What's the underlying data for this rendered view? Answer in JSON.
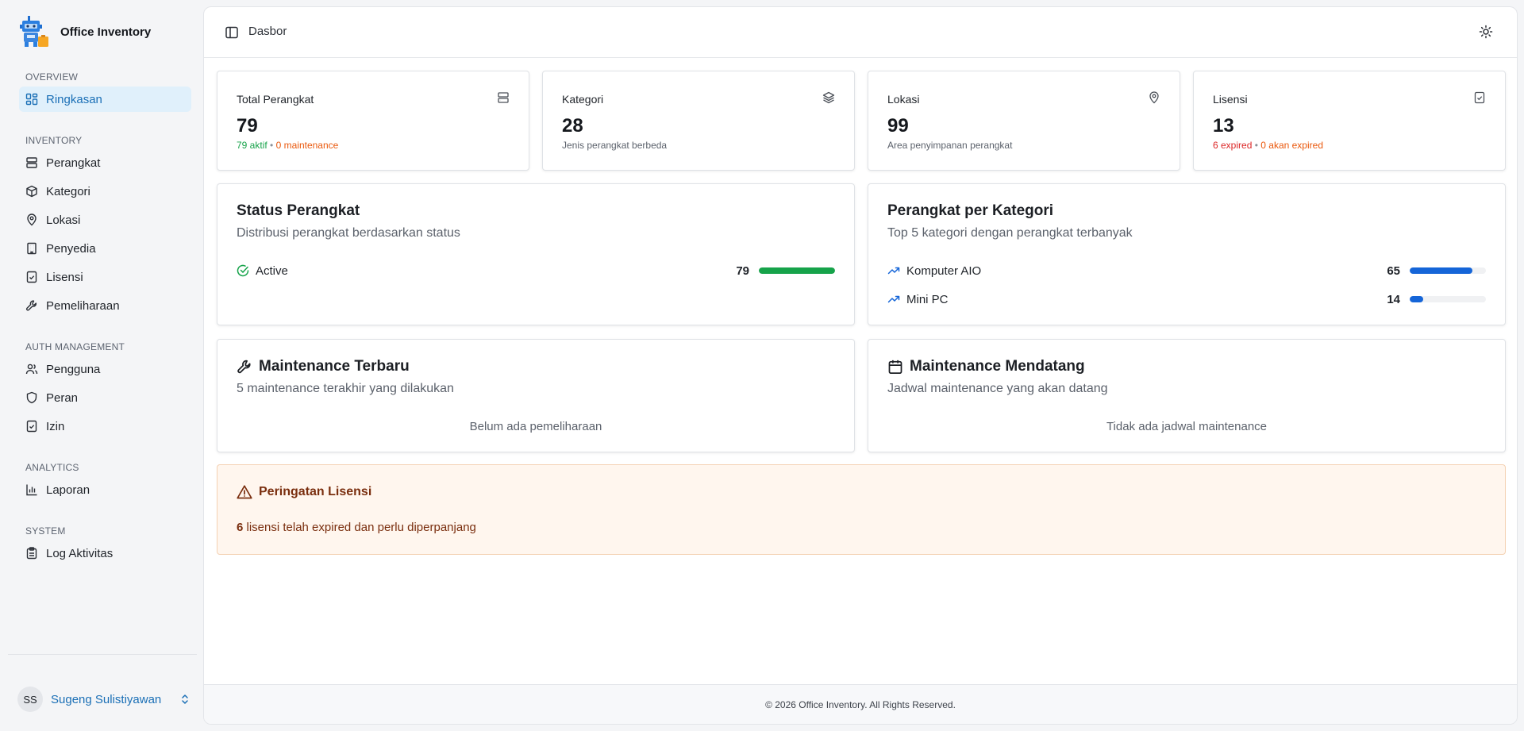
{
  "app": {
    "name": "Office Inventory"
  },
  "sidebar": {
    "sections": [
      {
        "heading": "OVERVIEW",
        "items": [
          {
            "label": "Ringkasan",
            "icon": "dashboard-icon",
            "active": true
          }
        ]
      },
      {
        "heading": "INVENTORY",
        "items": [
          {
            "label": "Perangkat",
            "icon": "server-icon"
          },
          {
            "label": "Kategori",
            "icon": "package-icon"
          },
          {
            "label": "Lokasi",
            "icon": "map-pin-icon"
          },
          {
            "label": "Penyedia",
            "icon": "building-icon"
          },
          {
            "label": "Lisensi",
            "icon": "file-check-icon"
          },
          {
            "label": "Pemeliharaan",
            "icon": "wrench-icon"
          }
        ]
      },
      {
        "heading": "AUTH MANAGEMENT",
        "items": [
          {
            "label": "Pengguna",
            "icon": "users-icon"
          },
          {
            "label": "Peran",
            "icon": "shield-icon"
          },
          {
            "label": "Izin",
            "icon": "file-check-icon"
          }
        ]
      },
      {
        "heading": "ANALYTICS",
        "items": [
          {
            "label": "Laporan",
            "icon": "bar-chart-icon"
          }
        ]
      },
      {
        "heading": "SYSTEM",
        "items": [
          {
            "label": "Log Aktivitas",
            "icon": "clipboard-icon"
          }
        ]
      }
    ]
  },
  "user": {
    "initials": "SS",
    "name": "Sugeng Sulistiyawan"
  },
  "header": {
    "breadcrumb": "Dasbor"
  },
  "stats": {
    "devices": {
      "title": "Total Perangkat",
      "value": "79",
      "active": "79 aktif",
      "sep": "•",
      "maintenance": "0 maintenance"
    },
    "categories": {
      "title": "Kategori",
      "value": "28",
      "sub": "Jenis perangkat berbeda"
    },
    "locations": {
      "title": "Lokasi",
      "value": "99",
      "sub": "Area penyimpanan perangkat"
    },
    "licenses": {
      "title": "Lisensi",
      "value": "13",
      "expired": "6 expired",
      "sep": "•",
      "expiring": "0 akan expired"
    }
  },
  "status_panel": {
    "title": "Status Perangkat",
    "subtitle": "Distribusi perangkat berdasarkan status",
    "rows": [
      {
        "label": "Active",
        "count": "79",
        "fraction": 1.0,
        "color": "#16a34a"
      }
    ]
  },
  "category_panel": {
    "title": "Perangkat per Kategori",
    "subtitle": "Top 5 kategori dengan perangkat terbanyak",
    "rows": [
      {
        "label": "Komputer AIO",
        "count": "65",
        "fraction": 0.82,
        "color": "#1565d8"
      },
      {
        "label": "Mini PC",
        "count": "14",
        "fraction": 0.18,
        "color": "#1565d8"
      }
    ]
  },
  "recent_maintenance": {
    "title": "Maintenance Terbaru",
    "subtitle": "5 maintenance terakhir yang dilakukan",
    "empty": "Belum ada pemeliharaan"
  },
  "upcoming_maintenance": {
    "title": "Maintenance Mendatang",
    "subtitle": "Jadwal maintenance yang akan datang",
    "empty": "Tidak ada jadwal maintenance"
  },
  "license_alert": {
    "title": "Peringatan Lisensi",
    "count": "6",
    "message": " lisensi telah expired dan perlu diperpanjang"
  },
  "footer": {
    "text": "© 2026 Office Inventory. All Rights Reserved."
  }
}
